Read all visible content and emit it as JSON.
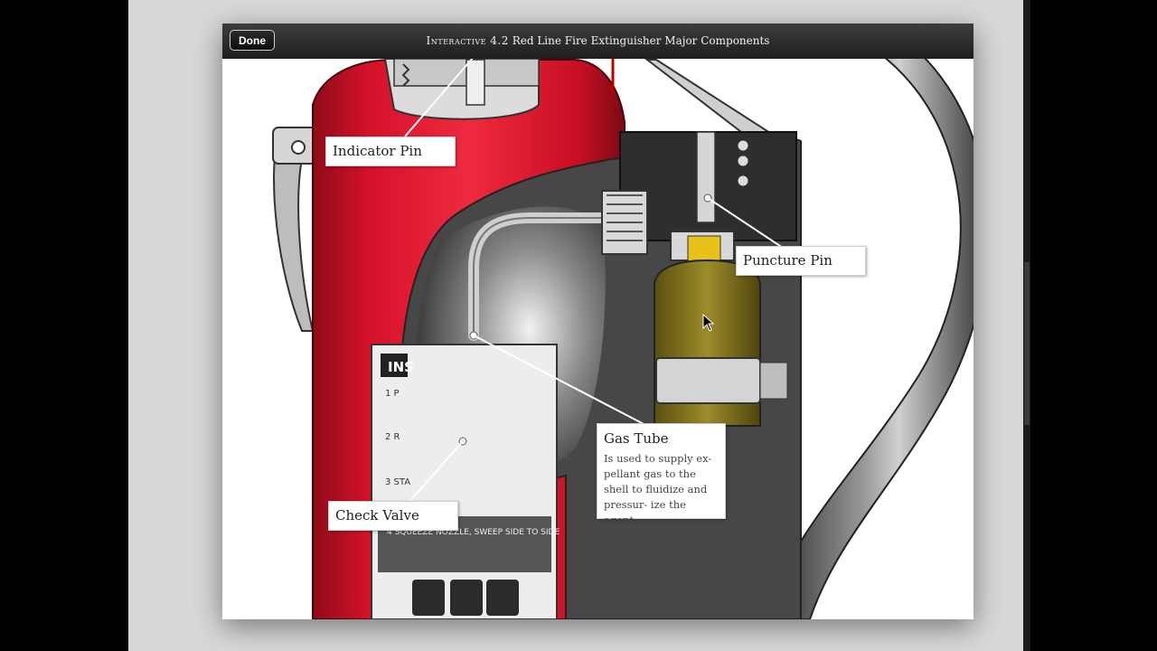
{
  "toolbar": {
    "done_label": "Done",
    "title_lead": "Interactive 4.2",
    "title_rest": " Red Line Fire Extinguisher Major Components"
  },
  "callouts": {
    "indicator_pin": "Indicator Pin",
    "puncture_pin": "Puncture Pin",
    "gas_tube": "Gas Tube",
    "gas_tube_desc": "Is used to supply ex- pellant gas to the shell to fluidize and pressur- ize the agent",
    "check_valve": "Check Valve"
  },
  "illustration": {
    "subject": "fire-extinguisher-cutaway",
    "label_plate_text": [
      "INS",
      "1 P",
      "2 R",
      "3 STA",
      "4 SQUEEZE NOZZLE, SWEEP SIDE TO SIDE"
    ]
  },
  "colors": {
    "shell_red": "#d4122a",
    "cartridge_gold": "#8a7a1e",
    "titlebar": "#2a2a2a"
  }
}
